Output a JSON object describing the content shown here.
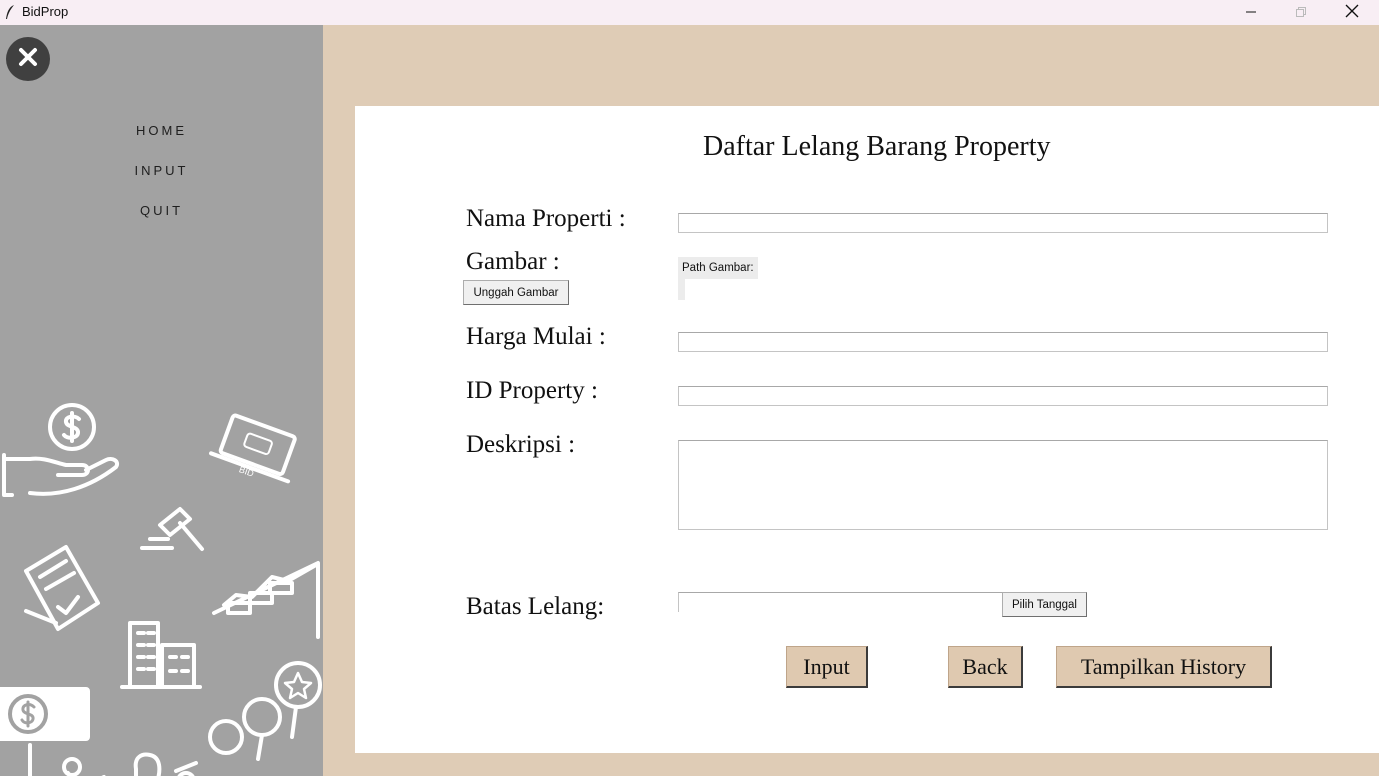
{
  "window": {
    "title": "BidProp"
  },
  "sidebar": {
    "menu": [
      {
        "label": "HOME"
      },
      {
        "label": "INPUT"
      },
      {
        "label": "QUIT"
      }
    ],
    "illustration_badge": "BID"
  },
  "form": {
    "title": "Daftar Lelang Barang Property",
    "nama_label": "Nama Properti :",
    "nama_value": "",
    "gambar_label": "Gambar :",
    "upload_button": "Unggah Gambar",
    "path_label": "Path Gambar:",
    "harga_label": "Harga Mulai :",
    "harga_value": "",
    "id_label": "ID Property :",
    "id_value": "",
    "deskripsi_label": "Deskripsi :",
    "deskripsi_value": "",
    "batas_label": "Batas Lelang:",
    "batas_value": "",
    "pilih_tanggal_button": "Pilih Tanggal"
  },
  "actions": {
    "input": "Input",
    "back": "Back",
    "history": "Tampilkan History"
  },
  "colors": {
    "background": "#dfccb6",
    "sidebar": "#a2a2a2",
    "button": "#dfc9b0",
    "titlebar": "#f8eef4"
  }
}
